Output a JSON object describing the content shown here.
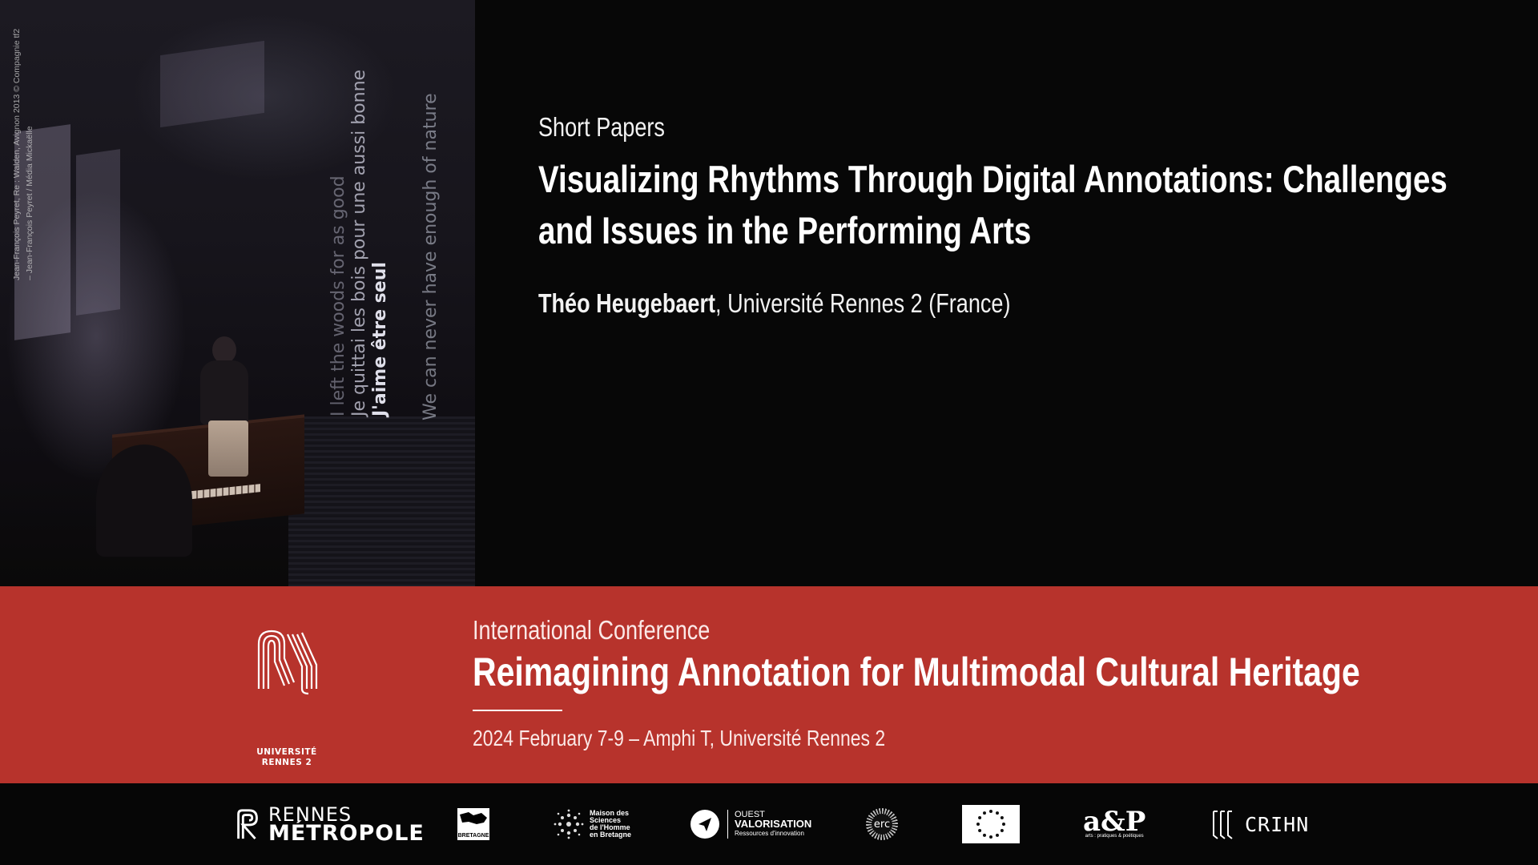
{
  "photo": {
    "credit_lines": [
      "Jean-François Peyret, Re : Walden, Avignon 2013 © Compagnie tf2",
      "– Jean-François Peyret / Médiа Mickaëlle"
    ],
    "projected_text": {
      "line1": "I left the woods for as good",
      "line2": "Je quittai les bois pour une aussi bonne",
      "line3": "J'aime être seul",
      "line4": "We can never have enough of nature"
    }
  },
  "session": {
    "type": "Short Papers",
    "title": "Visualizing Rhythms Through Digital Annotations: Challenges and Issues in the Performing Arts",
    "author_name": "Théo Heugebaert",
    "author_affiliation": ", Université Rennes 2 (France)"
  },
  "conference": {
    "kicker": "International Conference",
    "title": "Reimagining Annotation for Multimodal Cultural Heritage",
    "date_place": "2024 February 7-9 – Amphi T, Université Rennes 2",
    "logo_text_1": "UNIVERSITÉ",
    "logo_text_2": "RENNES 2"
  },
  "partners": {
    "rennes_metropole": {
      "line1": "RENNES",
      "line2": "MÉTROPOLE"
    },
    "region_bretagne": {
      "label": "BRETAGNE"
    },
    "msh": {
      "line1": "Maison des",
      "line2": "Sciences",
      "line3": "de l'Homme",
      "line4": "en Bretagne"
    },
    "ouest_valorisation": {
      "line1": "OUEST",
      "line2": "VALORISATION",
      "line3": "Ressources d'innovation"
    },
    "erc": {
      "label": "erc"
    },
    "eu_flag": {
      "icon": "eu-flag-icon"
    },
    "apz": {
      "label": "a&P",
      "sub": "arts : pratiques & poétiques"
    },
    "crihn": {
      "label": "CRIHN"
    }
  },
  "colors": {
    "background": "#070707",
    "conference_band": "#b7332c",
    "text": "#ffffff"
  }
}
